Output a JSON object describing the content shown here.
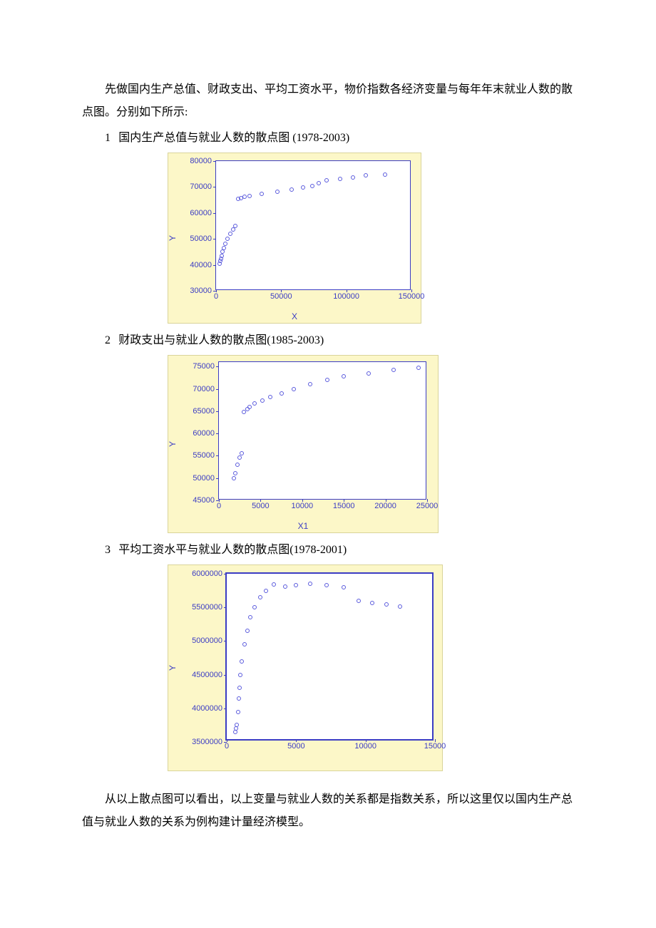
{
  "text": {
    "intro_1": "先做国内生产总值、财政支出、平均工资水平，物价指数各经济变量与每年年末就业人数的散点图。分别如下所示:",
    "item1": "国内生产总值与就业人数的散点图 (1978-2003)",
    "item2": "财政支出与就业人数的散点图(1985-2003)",
    "item3": "平均工资水平与就业人数的散点图(1978-2001)",
    "outro": "从以上散点图可以看出，以上变量与就业人数的关系都是指数关系，所以这里仅以国内生产总值与就业人数的关系为例构建计量经济模型。",
    "n1": "1",
    "n2": "2",
    "n3": "3"
  },
  "chart_data": [
    {
      "type": "scatter",
      "title": "",
      "xlabel": "X",
      "ylabel": "Y",
      "xlim": [
        0,
        150000
      ],
      "ylim": [
        30000,
        80000
      ],
      "xticks": [
        0,
        50000,
        100000,
        150000
      ],
      "yticks": [
        30000,
        40000,
        50000,
        60000,
        70000,
        80000
      ],
      "points": [
        {
          "x": 3000,
          "y": 40500
        },
        {
          "x": 3500,
          "y": 41500
        },
        {
          "x": 4000,
          "y": 42500
        },
        {
          "x": 4500,
          "y": 43500
        },
        {
          "x": 5000,
          "y": 45000
        },
        {
          "x": 6000,
          "y": 46500
        },
        {
          "x": 7000,
          "y": 48000
        },
        {
          "x": 9000,
          "y": 50000
        },
        {
          "x": 11000,
          "y": 52000
        },
        {
          "x": 13000,
          "y": 53500
        },
        {
          "x": 15000,
          "y": 55000
        },
        {
          "x": 17000,
          "y": 65500
        },
        {
          "x": 19000,
          "y": 65800
        },
        {
          "x": 22000,
          "y": 66200
        },
        {
          "x": 26000,
          "y": 66600
        },
        {
          "x": 35000,
          "y": 67500
        },
        {
          "x": 47000,
          "y": 68200
        },
        {
          "x": 58000,
          "y": 69000
        },
        {
          "x": 67000,
          "y": 69700
        },
        {
          "x": 74000,
          "y": 70500
        },
        {
          "x": 79000,
          "y": 71500
        },
        {
          "x": 85000,
          "y": 72500
        },
        {
          "x": 95000,
          "y": 73200
        },
        {
          "x": 105000,
          "y": 73800
        },
        {
          "x": 115000,
          "y": 74400
        },
        {
          "x": 130000,
          "y": 74800
        }
      ]
    },
    {
      "type": "scatter",
      "title": "",
      "xlabel": "X1",
      "ylabel": "Y",
      "xlim": [
        0,
        25000
      ],
      "ylim": [
        45000,
        76000
      ],
      "xticks": [
        0,
        5000,
        10000,
        15000,
        20000,
        25000
      ],
      "yticks": [
        45000,
        50000,
        55000,
        60000,
        65000,
        70000,
        75000
      ],
      "points": [
        {
          "x": 1800,
          "y": 49900
        },
        {
          "x": 2000,
          "y": 51000
        },
        {
          "x": 2200,
          "y": 53000
        },
        {
          "x": 2500,
          "y": 54600
        },
        {
          "x": 2700,
          "y": 55500
        },
        {
          "x": 3000,
          "y": 64800
        },
        {
          "x": 3400,
          "y": 65500
        },
        {
          "x": 3700,
          "y": 66000
        },
        {
          "x": 4300,
          "y": 66700
        },
        {
          "x": 5200,
          "y": 67400
        },
        {
          "x": 6200,
          "y": 68200
        },
        {
          "x": 7500,
          "y": 69000
        },
        {
          "x": 9000,
          "y": 69900
        },
        {
          "x": 11000,
          "y": 71000
        },
        {
          "x": 13000,
          "y": 72000
        },
        {
          "x": 15000,
          "y": 72800
        },
        {
          "x": 18000,
          "y": 73500
        },
        {
          "x": 21000,
          "y": 74200
        },
        {
          "x": 24000,
          "y": 74800
        }
      ]
    },
    {
      "type": "scatter",
      "title": "",
      "xlabel": "",
      "ylabel": "Y",
      "xlim": [
        0,
        15000
      ],
      "ylim": [
        3500000,
        6000000
      ],
      "xticks": [
        0,
        5000,
        10000,
        15000
      ],
      "yticks": [
        3500000,
        4000000,
        4500000,
        5000000,
        5500000,
        6000000
      ],
      "points": [
        {
          "x": 600,
          "y": 3650000
        },
        {
          "x": 650,
          "y": 3700000
        },
        {
          "x": 700,
          "y": 3750000
        },
        {
          "x": 800,
          "y": 3950000
        },
        {
          "x": 850,
          "y": 4150000
        },
        {
          "x": 900,
          "y": 4300000
        },
        {
          "x": 1000,
          "y": 4500000
        },
        {
          "x": 1100,
          "y": 4700000
        },
        {
          "x": 1300,
          "y": 4950000
        },
        {
          "x": 1500,
          "y": 5150000
        },
        {
          "x": 1700,
          "y": 5350000
        },
        {
          "x": 2000,
          "y": 5500000
        },
        {
          "x": 2400,
          "y": 5650000
        },
        {
          "x": 2800,
          "y": 5750000
        },
        {
          "x": 3400,
          "y": 5840000
        },
        {
          "x": 4200,
          "y": 5810000
        },
        {
          "x": 5000,
          "y": 5830000
        },
        {
          "x": 6000,
          "y": 5850000
        },
        {
          "x": 7200,
          "y": 5830000
        },
        {
          "x": 8400,
          "y": 5800000
        },
        {
          "x": 9500,
          "y": 5600000
        },
        {
          "x": 10500,
          "y": 5570000
        },
        {
          "x": 11500,
          "y": 5540000
        },
        {
          "x": 12500,
          "y": 5510000
        }
      ]
    }
  ]
}
